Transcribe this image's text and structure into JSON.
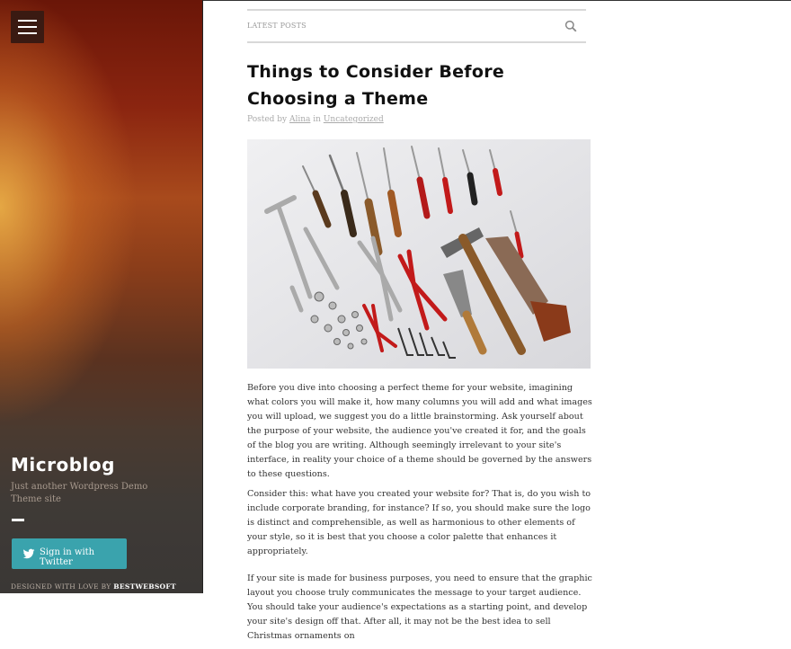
{
  "sidebar": {
    "menu_icon": "hamburger-icon",
    "site_title": "Microblog",
    "site_description": "Just another Wordpress Demo Theme site",
    "twitter_button": {
      "icon": "twitter-icon",
      "label": "Sign in with Twitter",
      "color": "#3aa3ad"
    },
    "credit_prefix": "DESIGNED WITH LOVE BY ",
    "credit_link": "BESTWEBSOFT"
  },
  "header_bar": {
    "label": "LATEST POSTS",
    "search_icon": "search-icon"
  },
  "post": {
    "title": "Things to Consider Before Choosing a Theme",
    "meta_prefix": "Posted by ",
    "author": "Alina",
    "meta_in": " in ",
    "category": "Uncategorized",
    "image_subject": "tools-photo",
    "paragraphs": [
      "Before you dive into choosing a perfect theme for your website, imagining what colors you will make it, how many columns you will add and what images you will upload, we suggest you do a little brainstorming. Ask yourself about the purpose of your website, the audience you've created it for, and the goals of the blog you are writing. Although seemingly irrelevant to your site's interface, in reality your choice of a theme should be governed by the answers to these questions.",
      "Consider this: what have you created your website for? That is, do you wish to include corporate branding, for instance? If so, you should make sure the logo is distinct and comprehensible, as well as harmonious to other elements of your style, so it is best that you choose a color palette that enhances it appropriately.",
      "If your site is made for business purposes, you need to ensure that the graphic layout you choose truly communicates the message to your target audience. You should take your audience's expectations as a starting point, and develop your site's design off that. After all, it may not be the best idea to sell Christmas ornaments on"
    ]
  }
}
